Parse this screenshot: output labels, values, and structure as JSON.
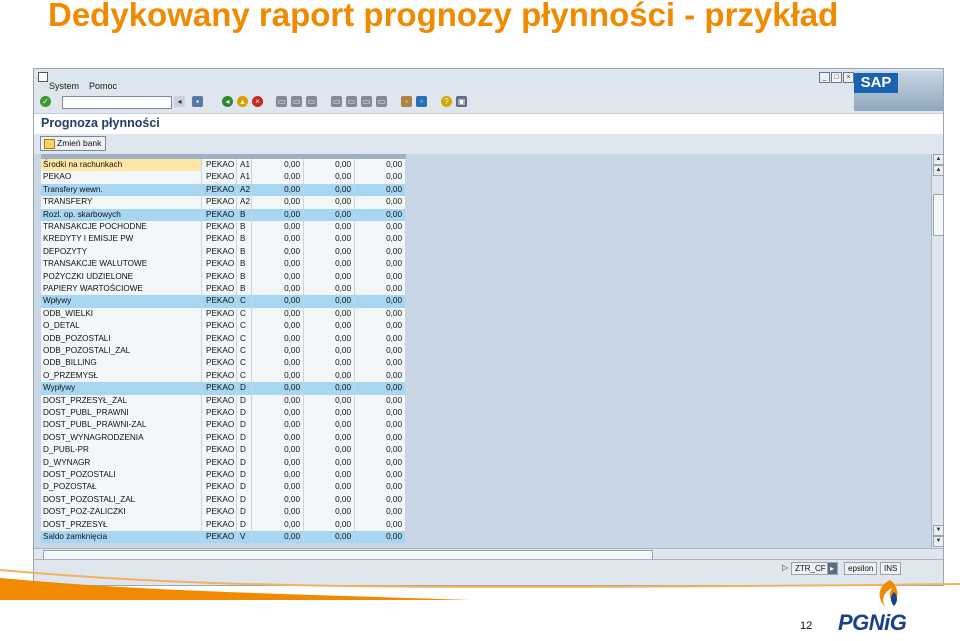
{
  "slide": {
    "title": "Dedykowany raport prognozy płynności - przykład",
    "page_number": "12",
    "logo_text": "PGNiG"
  },
  "menu": {
    "system": "System",
    "pomoc": "Pomoc"
  },
  "sap_logo": "SAP",
  "screen_title": "Prognoza płynności",
  "buttons": {
    "zmien_bank": "Zmień bank"
  },
  "rows": [
    {
      "name": "Środki na rachunkach",
      "bank": "PEKAO",
      "g": "A1",
      "v1": "0,00",
      "v2": "0,00",
      "v3": "0,00",
      "style": "y"
    },
    {
      "name": "PEKAO",
      "bank": "PEKAO",
      "g": "A1",
      "v1": "0,00",
      "v2": "0,00",
      "v3": "0,00",
      "style": "w"
    },
    {
      "name": "Transfery wewn.",
      "bank": "PEKAO",
      "g": "A2",
      "v1": "0,00",
      "v2": "0,00",
      "v3": "0,00",
      "style": "b"
    },
    {
      "name": "TRANSFERY",
      "bank": "PEKAO",
      "g": "A2",
      "v1": "0,00",
      "v2": "0,00",
      "v3": "0,00",
      "style": "w"
    },
    {
      "name": "Rozl. op. skarbowych",
      "bank": "PEKAO",
      "g": "B",
      "v1": "0,00",
      "v2": "0,00",
      "v3": "0,00",
      "style": "b"
    },
    {
      "name": "TRANSAKCJE POCHODNE",
      "bank": "PEKAO",
      "g": "B",
      "v1": "0,00",
      "v2": "0,00",
      "v3": "0,00",
      "style": "w"
    },
    {
      "name": "KREDYTY I EMISJE PW",
      "bank": "PEKAO",
      "g": "B",
      "v1": "0,00",
      "v2": "0,00",
      "v3": "0,00",
      "style": "w"
    },
    {
      "name": "DEPOZYTY",
      "bank": "PEKAO",
      "g": "B",
      "v1": "0,00",
      "v2": "0,00",
      "v3": "0,00",
      "style": "w"
    },
    {
      "name": "TRANSAKCJE WALUTOWE",
      "bank": "PEKAO",
      "g": "B",
      "v1": "0,00",
      "v2": "0,00",
      "v3": "0,00",
      "style": "w"
    },
    {
      "name": "POŻYCZKI UDZIELONE",
      "bank": "PEKAO",
      "g": "B",
      "v1": "0,00",
      "v2": "0,00",
      "v3": "0,00",
      "style": "w"
    },
    {
      "name": "PAPIERY WARTOŚCIOWE",
      "bank": "PEKAO",
      "g": "B",
      "v1": "0,00",
      "v2": "0,00",
      "v3": "0,00",
      "style": "w"
    },
    {
      "name": "Wpływy",
      "bank": "PEKAO",
      "g": "C",
      "v1": "0,00",
      "v2": "0,00",
      "v3": "0,00",
      "style": "b"
    },
    {
      "name": "ODB_WIELKI",
      "bank": "PEKAO",
      "g": "C",
      "v1": "0,00",
      "v2": "0,00",
      "v3": "0,00",
      "style": "w"
    },
    {
      "name": "O_DETAL",
      "bank": "PEKAO",
      "g": "C",
      "v1": "0,00",
      "v2": "0,00",
      "v3": "0,00",
      "style": "w"
    },
    {
      "name": "ODB_POZOSTALI",
      "bank": "PEKAO",
      "g": "C",
      "v1": "0,00",
      "v2": "0,00",
      "v3": "0,00",
      "style": "w"
    },
    {
      "name": "ODB_POZOSTALI_ZAL",
      "bank": "PEKAO",
      "g": "C",
      "v1": "0,00",
      "v2": "0,00",
      "v3": "0,00",
      "style": "w"
    },
    {
      "name": "ODB_BILLING",
      "bank": "PEKAO",
      "g": "C",
      "v1": "0,00",
      "v2": "0,00",
      "v3": "0,00",
      "style": "w"
    },
    {
      "name": "O_PRZEMYSŁ",
      "bank": "PEKAO",
      "g": "C",
      "v1": "0,00",
      "v2": "0,00",
      "v3": "0,00",
      "style": "w"
    },
    {
      "name": "Wypływy",
      "bank": "PEKAO",
      "g": "D",
      "v1": "0,00",
      "v2": "0,00",
      "v3": "0,00",
      "style": "b"
    },
    {
      "name": "DOST_PRZESYŁ_ZAL",
      "bank": "PEKAO",
      "g": "D",
      "v1": "0,00",
      "v2": "0,00",
      "v3": "0,00",
      "style": "w"
    },
    {
      "name": "DOST_PUBL_PRAWNI",
      "bank": "PEKAO",
      "g": "D",
      "v1": "0,00",
      "v2": "0,00",
      "v3": "0,00",
      "style": "w"
    },
    {
      "name": "DOST_PUBL_PRAWNI-ZAL",
      "bank": "PEKAO",
      "g": "D",
      "v1": "0,00",
      "v2": "0,00",
      "v3": "0,00",
      "style": "w"
    },
    {
      "name": "DOST_WYNAGRODZENIA",
      "bank": "PEKAO",
      "g": "D",
      "v1": "0,00",
      "v2": "0,00",
      "v3": "0,00",
      "style": "w"
    },
    {
      "name": "D_PUBL-PR",
      "bank": "PEKAO",
      "g": "D",
      "v1": "0,00",
      "v2": "0,00",
      "v3": "0,00",
      "style": "w"
    },
    {
      "name": "D_WYNAGR",
      "bank": "PEKAO",
      "g": "D",
      "v1": "0,00",
      "v2": "0,00",
      "v3": "0,00",
      "style": "w"
    },
    {
      "name": "DOST_POZOSTALI",
      "bank": "PEKAO",
      "g": "D",
      "v1": "0,00",
      "v2": "0,00",
      "v3": "0,00",
      "style": "w"
    },
    {
      "name": "D_POZOSTAŁ",
      "bank": "PEKAO",
      "g": "D",
      "v1": "0,00",
      "v2": "0,00",
      "v3": "0,00",
      "style": "w"
    },
    {
      "name": "DOST_POZOSTALI_ZAL",
      "bank": "PEKAO",
      "g": "D",
      "v1": "0,00",
      "v2": "0,00",
      "v3": "0,00",
      "style": "w"
    },
    {
      "name": "DOST_POZ-ZALICZKI",
      "bank": "PEKAO",
      "g": "D",
      "v1": "0,00",
      "v2": "0,00",
      "v3": "0,00",
      "style": "w"
    },
    {
      "name": "DOST_PRZESYŁ",
      "bank": "PEKAO",
      "g": "D",
      "v1": "0,00",
      "v2": "0,00",
      "v3": "0,00",
      "style": "w"
    },
    {
      "name": "Saldo zamknięcia",
      "bank": "PEKAO",
      "g": "V",
      "v1": "0,00",
      "v2": "0,00",
      "v3": "0,00",
      "style": "b"
    }
  ],
  "status": {
    "tcode": "ZTR_CF",
    "server": "epsilon",
    "mode": "INS"
  },
  "colors": {
    "title": "#f08a00",
    "row_highlight": "#a7d6f3",
    "row_selected": "#fde6a6",
    "background_area": "#c8d6e6"
  }
}
